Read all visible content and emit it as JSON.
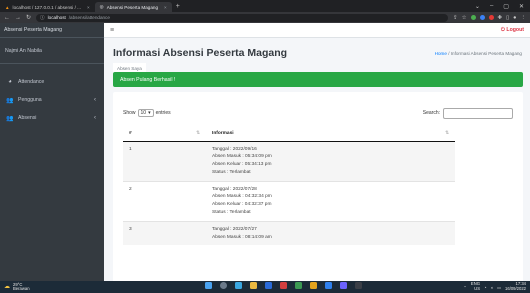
{
  "browser": {
    "tabs": [
      {
        "label": "localhost / 127.0.0.1 / absensi / ..."
      },
      {
        "label": "Absensi Peserta Magang"
      }
    ],
    "new_tab": "+",
    "url_host": "localhost",
    "url_path": "/absensi/attendance"
  },
  "sidebar": {
    "brand": "Absensi Peserta Magang",
    "user": "Najmi An Nabila",
    "items": [
      {
        "label": "Attendance",
        "icon": "chart-icon"
      },
      {
        "label": "Pengguna",
        "icon": "users-icon"
      },
      {
        "label": "Absensi",
        "icon": "users-icon"
      }
    ]
  },
  "topnav": {
    "logout": "Logout"
  },
  "content": {
    "title": "Informasi Absensi Peserta Magang",
    "breadcrumb_home": "Home",
    "breadcrumb_current": "Informasi Absensi Peserta Magang",
    "tab": "Absen Saya",
    "alert": "Absen Pulang Berhasil !",
    "show_label": "Show",
    "entries_value": "10",
    "entries_label": "entries",
    "search_label": "Search:"
  },
  "table": {
    "headers": [
      "#",
      "Informasi"
    ],
    "rows": [
      {
        "no": "1",
        "lines": [
          "Tanggal : 2022/09/16",
          "Absen Masuk : 05:34:09 pm",
          "Absen Keluar : 05:34:13 pm",
          "Status : Terlambat"
        ]
      },
      {
        "no": "2",
        "lines": [
          "Tanggal : 2022/07/28",
          "Absen Masuk : 04:32:34 pm",
          "Absen Keluar : 04:32:37 pm",
          "Status : Terlambat"
        ]
      },
      {
        "no": "3",
        "lines": [
          "Tanggal : 2022/07/27",
          "Absen Masuk : 08:14:09 am"
        ]
      }
    ]
  },
  "taskbar": {
    "weather_temp": "29°C",
    "weather_desc": "Berawan",
    "lang": "ENG",
    "lang_sub": "US",
    "time": "17:34",
    "date": "16/09/2022"
  }
}
